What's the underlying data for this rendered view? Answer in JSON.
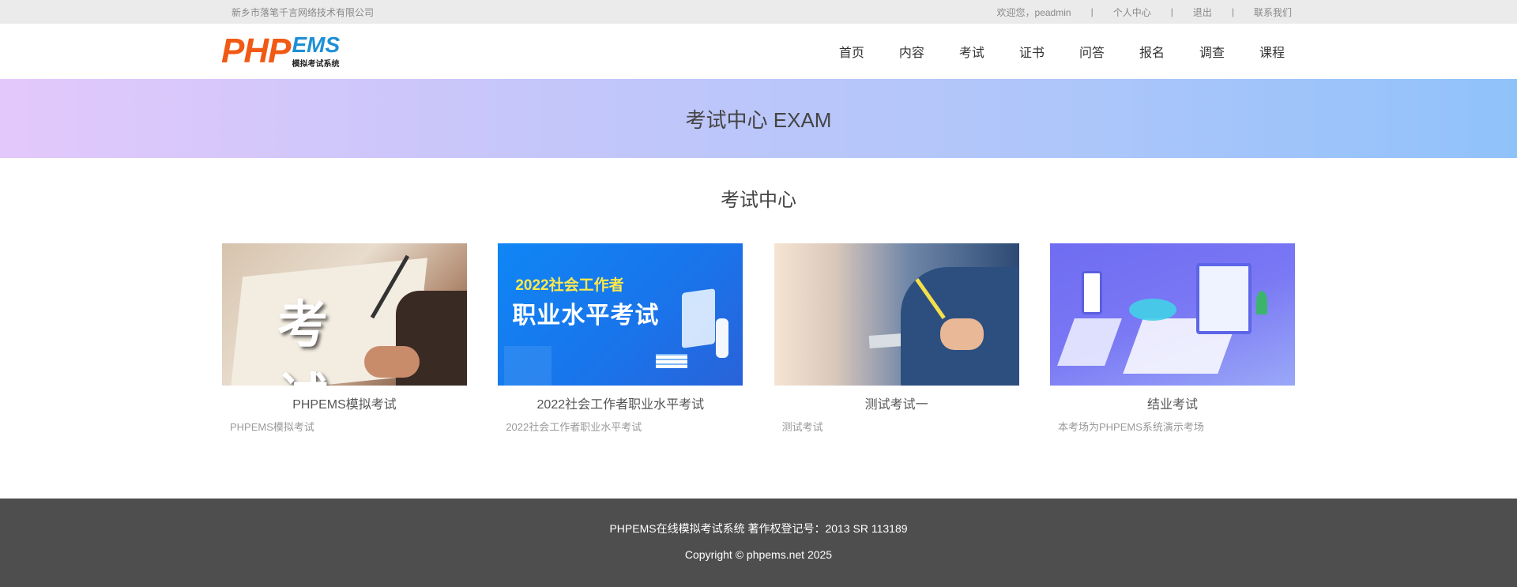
{
  "topbar": {
    "company": "新乡市落笔千言网络技术有限公司",
    "welcome": "欢迎您，peadmin",
    "separator": "|",
    "personal_center": "个人中心",
    "logout": "退出",
    "contact": "联系我们"
  },
  "logo": {
    "php": "PHP",
    "ems": "EMS",
    "subtitle": "模拟考试系统",
    "php_color": "#f05a14",
    "ems_color": "#1e8fd6"
  },
  "nav": {
    "items": [
      "首页",
      "内容",
      "考试",
      "证书",
      "问答",
      "报名",
      "调查",
      "课程"
    ]
  },
  "banner": {
    "title": "考试中心 EXAM"
  },
  "main": {
    "section_title": "考试中心",
    "cards": [
      {
        "image_text": "考 试",
        "title": "PHPEMS模拟考试",
        "desc": "PHPEMS模拟考试"
      },
      {
        "image_text_1": "2022社会工作者",
        "image_text_2": "职业水平考试",
        "title": "2022社会工作者职业水平考试",
        "desc": "2022社会工作者职业水平考试"
      },
      {
        "title": "测试考试一",
        "desc": "测试考试"
      },
      {
        "title": "结业考试",
        "desc": "本考场为PHPEMS系统演示考场"
      }
    ]
  },
  "footer": {
    "line1": "PHPEMS在线模拟考试系统 著作权登记号：2013 SR 113189",
    "line2": "Copyright © phpems.net 2025",
    "bg_color": "#4e4e4e"
  }
}
